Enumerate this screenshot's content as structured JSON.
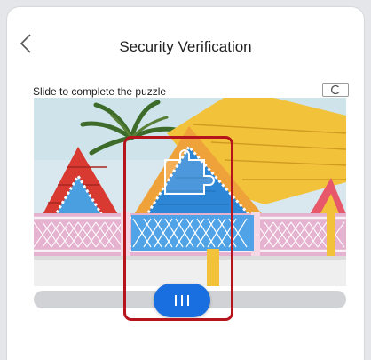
{
  "header": {
    "title": "Security Verification",
    "back_icon": "chevron-left-icon"
  },
  "captcha": {
    "instruction": "Slide to complete the puzzle",
    "refresh_icon": "refresh-icon",
    "image_description_icon": "puzzle-piece-icon",
    "slider_progress": 0.5,
    "accent_color": "#1a6fe0",
    "highlight_color": "#b5141c"
  }
}
